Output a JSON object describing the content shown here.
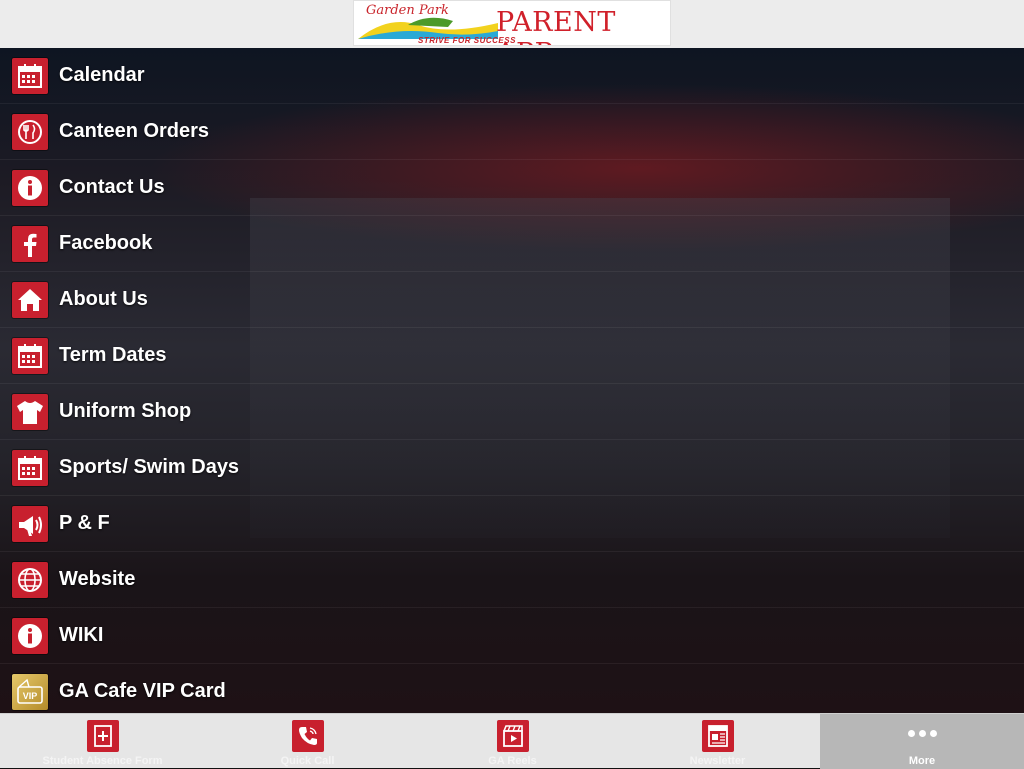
{
  "header": {
    "logo_script": "Garden Park",
    "logo_tagline": "STRIVE FOR SUCCESS",
    "app_name": "PARENT APP"
  },
  "menu": {
    "items": [
      {
        "label": "Calendar",
        "icon": "calendar-icon"
      },
      {
        "label": "Canteen Orders",
        "icon": "canteen-icon"
      },
      {
        "label": "Contact Us",
        "icon": "info-icon"
      },
      {
        "label": "Facebook",
        "icon": "facebook-icon"
      },
      {
        "label": "About Us",
        "icon": "home-icon"
      },
      {
        "label": "Term Dates",
        "icon": "calendar-icon"
      },
      {
        "label": "Uniform Shop",
        "icon": "shirt-icon"
      },
      {
        "label": "Sports/ Swim Days",
        "icon": "calendar-icon"
      },
      {
        "label": "P & F",
        "icon": "megaphone-icon"
      },
      {
        "label": "Website",
        "icon": "globe-icon"
      },
      {
        "label": "WIKI",
        "icon": "info-icon"
      },
      {
        "label": "GA Cafe VIP Card",
        "icon": "vip-card-icon"
      }
    ]
  },
  "tabbar": {
    "tabs": [
      {
        "label": "Student Absence Form",
        "icon": "form-icon"
      },
      {
        "label": "Quick Call",
        "icon": "phone-icon"
      },
      {
        "label": "GA Reels",
        "icon": "film-icon"
      },
      {
        "label": "Newsletter",
        "icon": "newspaper-icon"
      },
      {
        "label": "More",
        "icon": "more-dots-icon"
      }
    ]
  },
  "colors": {
    "accent": "#c8202e",
    "tabbar_bg": "#e6e6e6",
    "tab_active_bg": "#b7b7b7"
  }
}
